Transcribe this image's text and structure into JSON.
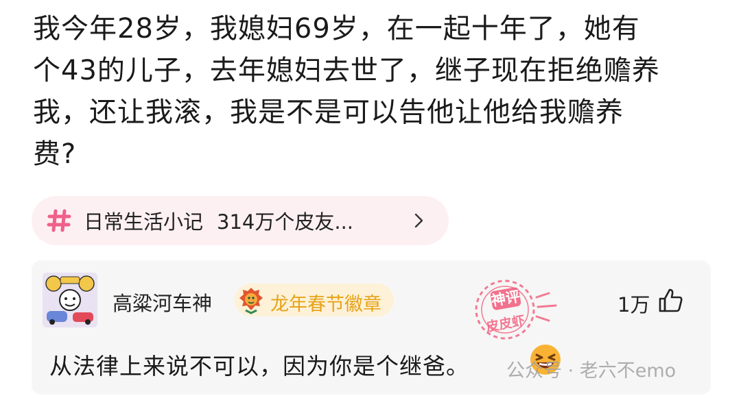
{
  "post": {
    "lines": [
      "我今年28岁，我媳妇69岁，在一起十年了，她有",
      "个43的儿子，去年媳妇去世了，继子现在拒绝赡养",
      "我，还让我滚，我是不是可以告他让他给我赡养",
      "费?"
    ]
  },
  "topic": {
    "icon": "hash-icon",
    "name": "日常生活小记",
    "count": "314万个皮友...",
    "accent": "#f0608a",
    "chip_bg": "#fdf0f3"
  },
  "comment": {
    "username": "高粱河车神",
    "badge": {
      "icon": "dragon-badge-icon",
      "label": "龙年春节徽章",
      "color": "#e6a417",
      "bg": "#fdf1d8"
    },
    "stamp": {
      "top": "神评",
      "bottom": "皮皮虾",
      "color": "#f25a7a"
    },
    "likes": "1万",
    "text": "从法律上来说不可以，因为你是个继爸。",
    "emoji": "laughing-emoji",
    "card_bg": "#f6f6f6"
  },
  "watermark": {
    "text": "公众号 · 老六不emo"
  }
}
